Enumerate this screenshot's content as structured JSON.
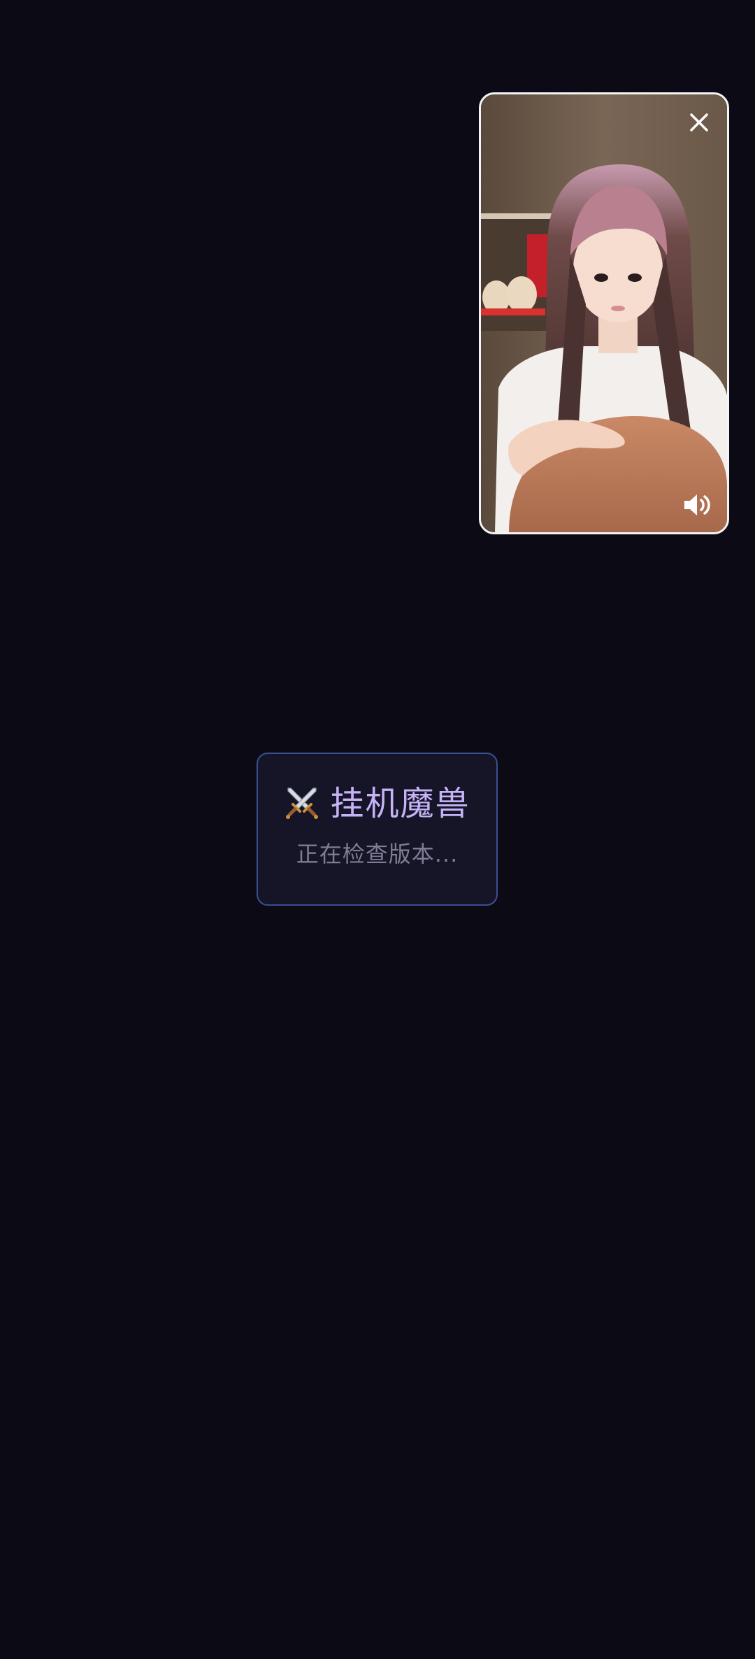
{
  "video_window": {
    "close_icon": "close-icon",
    "speaker_icon": "speaker-volume-icon"
  },
  "loading_card": {
    "icon": "crossed-swords-icon",
    "title": "挂机魔兽",
    "status": "正在检查版本..."
  },
  "colors": {
    "background": "#0c0b15",
    "card_background": "#151527",
    "card_border": "#3a4f94",
    "title": "#c6b3f7",
    "status": "#7f7d93",
    "video_border": "#f4f4f6"
  }
}
